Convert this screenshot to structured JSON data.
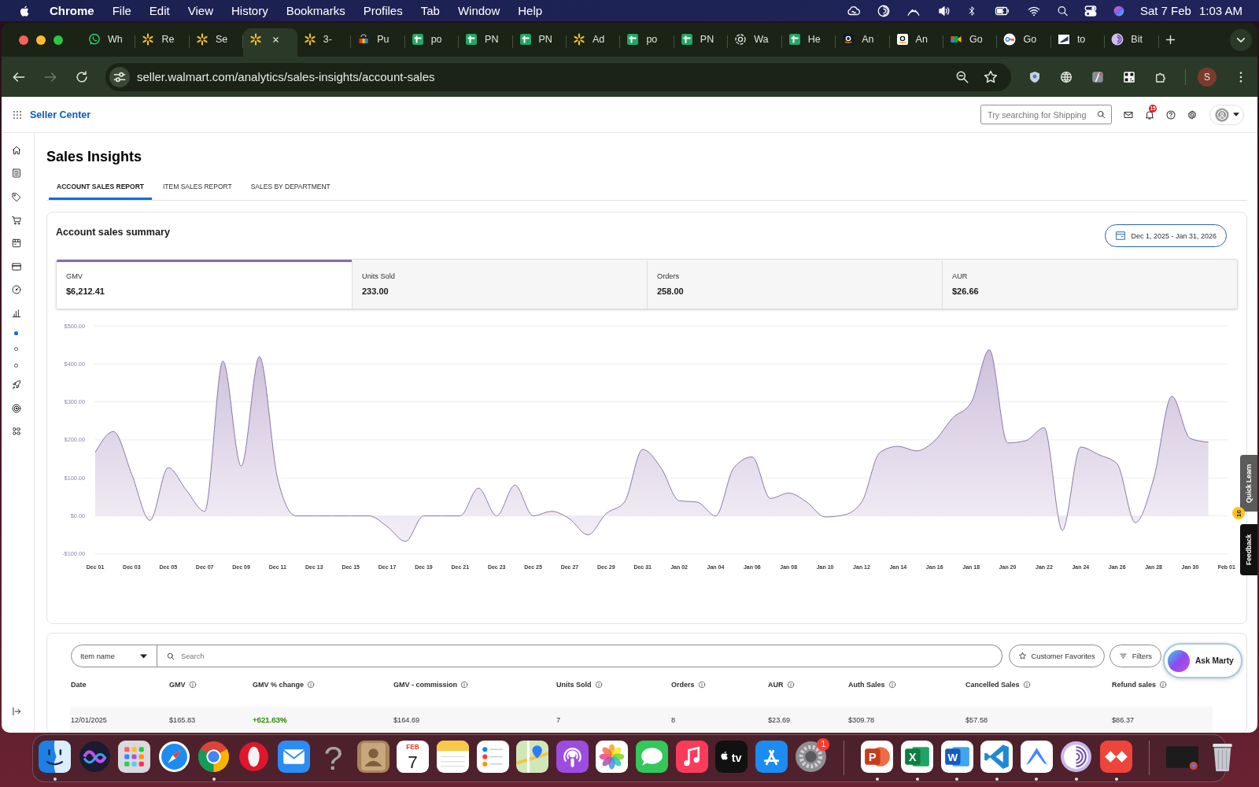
{
  "menu_bar": {
    "app_name": "Chrome",
    "menus": [
      "File",
      "Edit",
      "View",
      "History",
      "Bookmarks",
      "Profiles",
      "Tab",
      "Window",
      "Help"
    ],
    "date": "Sat 7 Feb",
    "time": "1:03 AM"
  },
  "browser": {
    "tabs": [
      {
        "title": "Wh",
        "kind": "chat",
        "selected": false
      },
      {
        "title": "Re",
        "kind": "spark",
        "selected": false
      },
      {
        "title": "Se",
        "kind": "spark",
        "selected": false
      },
      {
        "kind": "spark",
        "selected": true
      },
      {
        "title": "3-",
        "kind": "spark",
        "selected": false
      },
      {
        "title": "Pu",
        "kind": "bag",
        "selected": false
      },
      {
        "title": "po",
        "kind": "sheet",
        "selected": false
      },
      {
        "title": "PN",
        "kind": "sheet",
        "selected": false
      },
      {
        "title": "PN",
        "kind": "sheet",
        "selected": false
      },
      {
        "title": "Ad",
        "kind": "spark",
        "selected": false
      },
      {
        "title": "po",
        "kind": "sheet",
        "selected": false
      },
      {
        "title": "PN",
        "kind": "sheet",
        "selected": false
      },
      {
        "title": "Wa",
        "kind": "knot",
        "selected": false
      },
      {
        "title": "He",
        "kind": "sheet",
        "selected": false
      },
      {
        "title": "An",
        "kind": "smile-dark",
        "selected": false
      },
      {
        "title": "An",
        "kind": "smile-light",
        "selected": false
      },
      {
        "title": "Go",
        "kind": "camera",
        "selected": false
      },
      {
        "title": "Go",
        "kind": "key",
        "selected": false
      },
      {
        "title": "to",
        "kind": "stripe",
        "selected": false
      },
      {
        "title": "Bit",
        "kind": "swirl",
        "selected": false
      }
    ],
    "address": "seller.walmart.com/analytics/sales-insights/account-sales",
    "profile_initial": "S"
  },
  "header": {
    "brand": "Seller Center",
    "search": {
      "placeholder": "Try searching for Shipping"
    },
    "notification_count": "15"
  },
  "sidebar": {
    "subitems": [
      {
        "selected": true
      },
      {
        "selected": false
      },
      {
        "selected": false
      }
    ]
  },
  "page": {
    "title": "Sales Insights",
    "tabs": [
      {
        "label": "ACCOUNT SALES REPORT",
        "selected": true
      },
      {
        "label": "ITEM SALES REPORT",
        "selected": false
      },
      {
        "label": "SALES BY DEPARTMENT",
        "selected": false
      }
    ]
  },
  "summary": {
    "title": "Account sales summary",
    "date_range": "Dec 1, 2025 - Jan 31, 2026",
    "metrics": [
      {
        "label": "GMV",
        "value": "$6,212.41",
        "selected": true
      },
      {
        "label": "Units Sold",
        "value": "233.00",
        "selected": false
      },
      {
        "label": "Orders",
        "value": "258.00",
        "selected": false
      },
      {
        "label": "AUR",
        "value": "$26.66",
        "selected": false
      }
    ],
    "chart_data": {
      "type": "area",
      "grid": true,
      "categories": [
        "Dec 01",
        null,
        "Dec 03",
        null,
        "Dec 05",
        null,
        "Dec 07",
        null,
        "Dec 09",
        null,
        "Dec 11",
        null,
        "Dec 13",
        null,
        "Dec 15",
        null,
        "Dec 17",
        null,
        "Dec 19",
        null,
        "Dec 21",
        null,
        "Dec 23",
        null,
        "Dec 25",
        null,
        "Dec 27",
        null,
        "Dec 29",
        null,
        "Dec 31",
        null,
        "Jan 02",
        null,
        "Jan 04",
        null,
        "Jan 06",
        null,
        "Jan 08",
        null,
        "Jan 10",
        null,
        "Jan 12",
        null,
        "Jan 14",
        null,
        "Jan 16",
        null,
        "Jan 18",
        null,
        "Jan 20",
        null,
        "Jan 22",
        null,
        "Jan 24",
        null,
        "Jan 26",
        null,
        "Jan 28",
        null,
        "Jan 30",
        null,
        "Feb 01"
      ],
      "values": [
        167,
        222,
        110,
        -12,
        127,
        67,
        12,
        407,
        131,
        419,
        97,
        0,
        0,
        0,
        0,
        0,
        -28,
        -67,
        0,
        0,
        0,
        73,
        0,
        81,
        0,
        12,
        -8,
        -50,
        6,
        36,
        175,
        127,
        40,
        36,
        0,
        127,
        155,
        46,
        60,
        36,
        -3,
        2,
        36,
        167,
        183,
        171,
        198,
        258,
        298,
        437,
        192,
        198,
        232,
        -38,
        181,
        161,
        137,
        -18,
        97,
        315,
        204,
        194,
        null
      ],
      "ylim": [
        -100,
        500
      ],
      "yticks": [
        {
          "value": -100,
          "label": "-$100.00"
        },
        {
          "value": 0,
          "label": "$0.00"
        },
        {
          "value": 100,
          "label": "$100.00"
        },
        {
          "value": 200,
          "label": "$200.00"
        },
        {
          "value": 300,
          "label": "$300.00"
        },
        {
          "value": 400,
          "label": "$400.00"
        },
        {
          "value": 500,
          "label": "$500.00"
        }
      ]
    }
  },
  "table": {
    "filter": {
      "value": "Item name"
    },
    "search": {
      "placeholder": "Search"
    },
    "buttons": [
      {
        "label": "Customer Favorites",
        "kind": "star"
      },
      {
        "label": "Filters",
        "kind": "filter"
      }
    ],
    "assistant": {
      "label": "Ask Marty"
    },
    "columns": [
      {
        "label": "Date",
        "info": false
      },
      {
        "label": "GMV",
        "info": true
      },
      {
        "label": "GMV % change",
        "info": true
      },
      {
        "label": "GMV - commission",
        "info": true
      },
      {
        "label": "Units Sold",
        "info": true
      },
      {
        "label": "Orders",
        "info": true
      },
      {
        "label": "AUR",
        "info": true
      },
      {
        "label": "Auth Sales",
        "info": true
      },
      {
        "label": "Cancelled Sales",
        "info": true
      },
      {
        "label": "Refund sales",
        "info": true
      }
    ],
    "rows": [
      {
        "cells": [
          {
            "text": "12/01/2025"
          },
          {
            "text": "$165.83"
          },
          {
            "text": "+621.63%",
            "color": "#2a8703"
          },
          {
            "text": "$164.69"
          },
          {
            "text": "7"
          },
          {
            "text": "8"
          },
          {
            "text": "$23.69"
          },
          {
            "text": "$309.78"
          },
          {
            "text": "$57.58"
          },
          {
            "text": "$86.37"
          }
        ]
      }
    ]
  },
  "side_tabs": [
    {
      "kind": "quick-learn",
      "label": "Quick Learn",
      "badge": "10"
    },
    {
      "kind": "feedback",
      "label": "Feedback"
    }
  ],
  "dock": {
    "sections": [
      {
        "apps": [
          {
            "kind": "finder",
            "running": true
          },
          {
            "kind": "orb",
            "running": false
          },
          {
            "kind": "launcher",
            "running": false
          },
          {
            "kind": "compass",
            "running": false
          },
          {
            "kind": "browser",
            "running": true
          },
          {
            "kind": "ring",
            "running": false
          },
          {
            "kind": "envelope",
            "running": false
          },
          {
            "kind": "unknown",
            "glyph": "?",
            "running": false
          },
          {
            "kind": "contacts",
            "running": false
          },
          {
            "kind": "calendar",
            "month": "FEB",
            "day": "7",
            "running": false
          },
          {
            "kind": "notes",
            "running": false
          },
          {
            "kind": "reminders",
            "running": false
          },
          {
            "kind": "map",
            "running": false
          },
          {
            "kind": "podcast",
            "running": false
          },
          {
            "kind": "petals",
            "running": false
          },
          {
            "kind": "bubble",
            "running": false
          },
          {
            "kind": "note",
            "running": false
          },
          {
            "kind": "tv",
            "glyph": "tv",
            "running": false
          },
          {
            "kind": "store",
            "running": false
          },
          {
            "kind": "gear",
            "badge": "1",
            "running": false
          }
        ]
      },
      {
        "apps": [
          {
            "kind": "slides",
            "glyph": "P",
            "running": true
          },
          {
            "kind": "sheets",
            "glyph": "X",
            "running": true
          },
          {
            "kind": "doc",
            "glyph": "W",
            "running": true
          },
          {
            "kind": "code",
            "running": true
          },
          {
            "kind": "mountain",
            "running": true
          },
          {
            "kind": "swirl",
            "running": true
          },
          {
            "kind": "diamonds",
            "running": true
          }
        ]
      },
      {
        "apps": [
          {
            "kind": "window",
            "running": false
          },
          {
            "kind": "trash",
            "running": false
          }
        ]
      }
    ]
  }
}
